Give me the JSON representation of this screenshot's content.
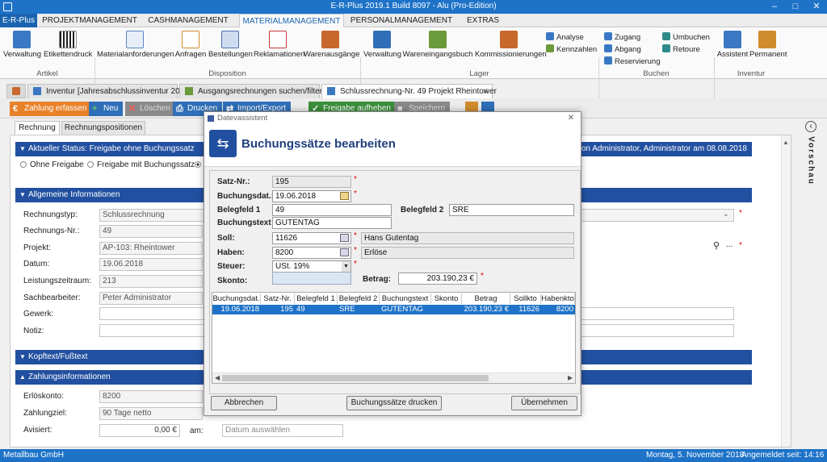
{
  "window": {
    "title": "E-R-Plus 2019.1 Build 8097 -  Alu (Pro-Edition)"
  },
  "ribbon_tabs": [
    "E-R-Plus",
    "PROJEKTMANAGEMENT",
    "CASHMANAGEMENT",
    "MATERIALMANAGEMENT",
    "PERSONALMANAGEMENT",
    "EXTRAS"
  ],
  "ribbon": {
    "artikel": [
      "Verwaltung",
      "Etikettendruck"
    ],
    "disposition": [
      "Materialanforderungen",
      "Anfragen",
      "Bestellungen",
      "Reklamationen",
      "Warenausgänge"
    ],
    "lager": [
      "Verwaltung",
      "Wareneingangsbuch",
      "Kommissionierungen"
    ],
    "lager_small": [
      "Analyse",
      "Kennzahlen"
    ],
    "buchen": [
      "Zugang",
      "Abgang",
      "Reservierung",
      "Umbuchen",
      "Retoure"
    ],
    "inventur": [
      "Assistent",
      "Permanent"
    ],
    "groups": [
      "Artikel",
      "Disposition",
      "Lager",
      "Buchen",
      "Inventur"
    ]
  },
  "doc_tabs": [
    "Inventur [Jahresabschlussinventur 2018]",
    "Ausgangsrechnungen suchen/filtern",
    "Schlussrechnung-Nr. 49 Projekt Rheintower"
  ],
  "toolbar": [
    "Zahlung erfassen",
    "Neu",
    "Löschen",
    "Drucken",
    "Import/Export",
    "Freigabe aufheben",
    "Speichern"
  ],
  "sub_tabs": [
    "Rechnung",
    "Rechnungspositionen"
  ],
  "vorschau": "Vorschau",
  "status_section": {
    "title": "Aktueller Status: Freigabe ohne Buchungssatz",
    "right_text": "llt von Administrator, Administrator am 08.08.2018",
    "radios": [
      "Ohne Freigabe",
      "Freigabe mit Buchungssatz"
    ]
  },
  "allgemein": {
    "title": "Allgemeine Informationen",
    "fields": [
      {
        "label": "Rechnungstyp:",
        "value": "Schlussrechnung"
      },
      {
        "label": "Rechnungs-Nr.:",
        "value": "49"
      },
      {
        "label": "Projekt:",
        "value": "AP-103: Rheintower"
      },
      {
        "label": "Datum:",
        "value": "19.06.2018"
      },
      {
        "label": "Leistungszeitraum:",
        "value": "213"
      },
      {
        "label": "Sachbearbeiter:",
        "value": "Peter Administrator"
      },
      {
        "label": "Gewerk:",
        "value": ""
      },
      {
        "label": "Notiz:",
        "value": ""
      }
    ]
  },
  "kopftext": {
    "title": "Kopftext/Fußtext"
  },
  "zahlung": {
    "title": "Zahlungsinformationen",
    "erloeskonto_label": "Erlöskonto:",
    "erloeskonto": "8200",
    "zahlungsziel_label": "Zahlungziel:",
    "zahlungsziel": "90 Tage netto",
    "avisiert_label": "Avisiert:",
    "avisiert": "0,00 €",
    "am_label": "am:",
    "am_placeholder": "Datum auswählen"
  },
  "dialog": {
    "window_title": "Datevassistent",
    "heading": "Buchungssätze bearbeiten",
    "satz_nr_label": "Satz-Nr.:",
    "satz_nr": "195",
    "buchungsdat_label": "Buchungsdat.:",
    "buchungsdat": "19.06.2018",
    "belegfeld1_label": "Belegfeld 1",
    "belegfeld1": "49",
    "belegfeld2_label": "Belegfeld 2",
    "belegfeld2": "SRE",
    "buchungstext_label": "Buchungstext",
    "buchungstext": "GUTENTAG",
    "soll_label": "Soll:",
    "soll": "11626",
    "soll_name": "Hans Gutentag",
    "haben_label": "Haben:",
    "haben": "8200",
    "haben_name": "Erlöse",
    "steuer_label": "Steuer:",
    "steuer": "USt. 19%",
    "skonto_label": "Skonto:",
    "skonto": "",
    "betrag_label": "Betrag:",
    "betrag": "203.190,23 €",
    "grid_headers": [
      "Buchungsdat.",
      "Satz-Nr.",
      "Belegfeld 1",
      "Belegfeld 2",
      "Buchungstext",
      "Skonto",
      "Betrag",
      "Sollkto",
      "Habenkto"
    ],
    "grid_row": [
      "19.06.2018",
      "195",
      "49",
      "SRE",
      "GUTENTAG",
      "",
      "203.190,23 €",
      "11626",
      "8200"
    ],
    "buttons": {
      "cancel": "Abbrechen",
      "print": "Buchungssätze drucken",
      "accept": "Übernehmen"
    }
  },
  "statusbar": {
    "company": "Metallbau GmbH",
    "date": "Montag, 5. November 2018",
    "logged": "Angemeldet seit: 14:16"
  },
  "colors": {
    "titlebar": "#1e73c8",
    "section": "#2250a0",
    "selection": "#1e73c8",
    "accent_orange": "#e8822a",
    "accent_green": "#3a8f3a"
  }
}
